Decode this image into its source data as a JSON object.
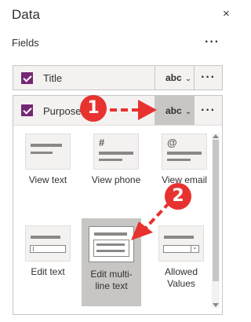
{
  "panel": {
    "title": "Data",
    "close_glyph": "×"
  },
  "fields": {
    "label": "Fields",
    "more_glyph": "···"
  },
  "rows": [
    {
      "label": "Title",
      "type_label": "abc",
      "chevron": "⌄",
      "more_glyph": "···"
    },
    {
      "label": "Purpose",
      "type_label": "abc",
      "chevron": "⌄",
      "more_glyph": "···"
    }
  ],
  "control_options": [
    {
      "label": "View text",
      "icon": "view-text-icon"
    },
    {
      "label": "View phone",
      "icon": "view-phone-icon",
      "glyph": "#"
    },
    {
      "label": "View email",
      "icon": "view-email-icon",
      "glyph": "@"
    },
    {
      "label": "Edit text",
      "icon": "edit-text-icon"
    },
    {
      "label": "Edit multi-line text",
      "icon": "edit-multiline-icon",
      "selected": true
    },
    {
      "label": "Allowed Values",
      "icon": "allowed-values-icon"
    }
  ],
  "annotations": [
    {
      "number": "1",
      "color": "#e8322f"
    },
    {
      "number": "2",
      "color": "#e8322f"
    }
  ],
  "colors": {
    "checkbox": "#742774",
    "selected_tile": "#c8c6c4",
    "callout": "#e8322f"
  }
}
